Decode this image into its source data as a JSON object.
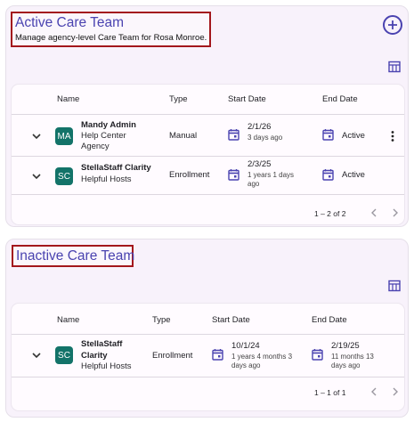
{
  "active_section": {
    "title": "Active Care Team",
    "subtitle": "Manage agency-level Care Team for Rosa Monroe.",
    "add_icon": "plus-circle-icon",
    "view_icon": "table-view-icon",
    "columns": {
      "name": "Name",
      "type": "Type",
      "start": "Start Date",
      "end": "End Date"
    },
    "rows": [
      {
        "initials": "MA",
        "name": "Mandy Admin",
        "org_line1": "Help Center",
        "org_line2": "Agency",
        "type": "Manual",
        "start": "2/1/26",
        "start_ago_1": "3 days ago",
        "start_ago_2": "",
        "start_ago_3": "",
        "end": "Active"
      },
      {
        "initials": "SC",
        "name": "StellaStaff Clarity",
        "org_line1": "Helpful Hosts",
        "type": "Enrollment",
        "start": "2/3/25",
        "start_ago_1": "1 years 1 days",
        "start_ago_2": "ago",
        "end": "Active"
      }
    ],
    "pager": "1 – 2 of 2"
  },
  "inactive_section": {
    "title": "Inactive Care Team",
    "view_icon": "table-view-icon",
    "columns": {
      "name": "Name",
      "type": "Type",
      "start": "Start Date",
      "end": "End Date"
    },
    "rows": [
      {
        "initials": "SC",
        "name_line1": "StellaStaff",
        "name_line2": "Clarity",
        "org_line1": "Helpful Hosts",
        "type": "Enrollment",
        "start": "10/1/24",
        "start_ago_1": "1 years 4 months 3",
        "start_ago_2": "days ago",
        "end": "2/19/25",
        "end_ago_1": "11 months 13",
        "end_ago_2": "days ago"
      }
    ],
    "pager": "1 – 1 of 1"
  },
  "colors": {
    "accent": "#4a43b0",
    "avatar": "#137369",
    "highlight_border": "#a3171c",
    "card_bg": "#f8f2fb"
  }
}
